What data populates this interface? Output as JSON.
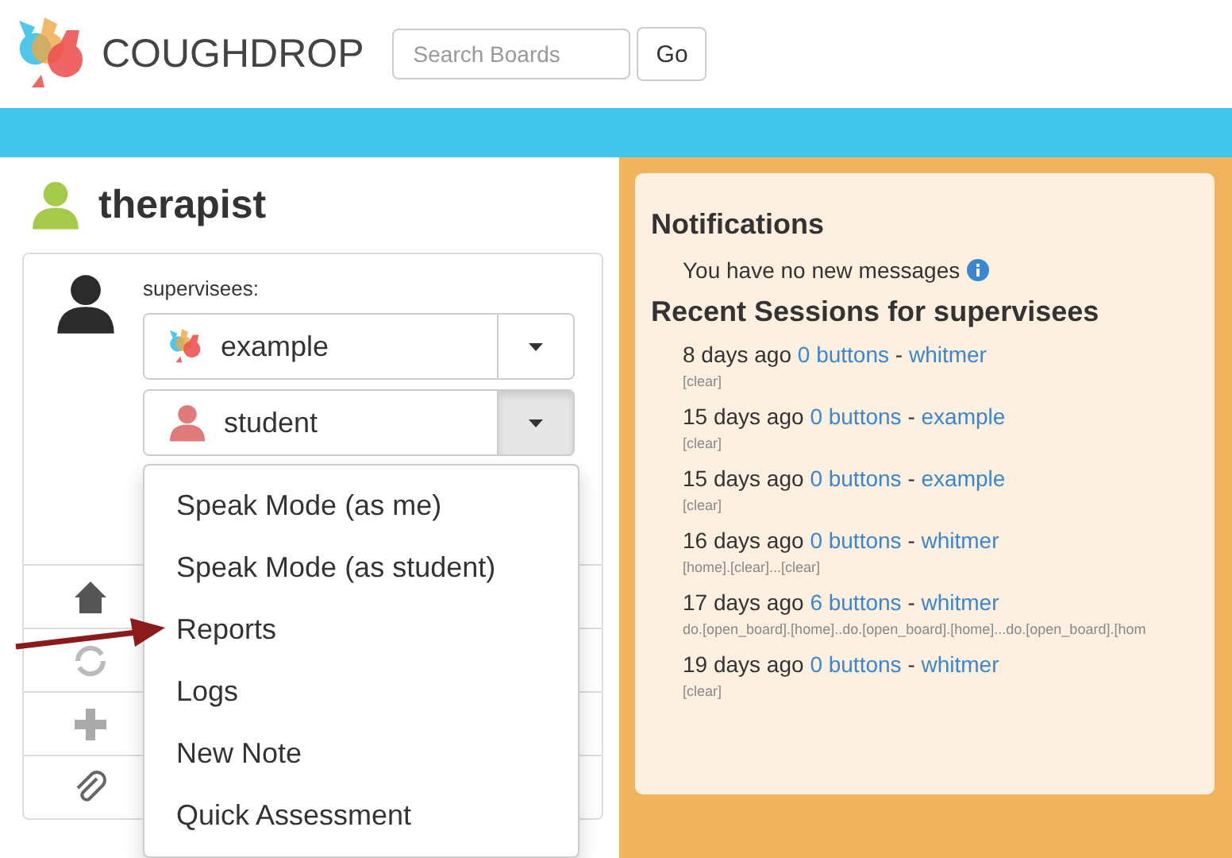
{
  "header": {
    "brand": "COUGHDROP",
    "search": {
      "placeholder": "Search Boards"
    },
    "go_button": "Go"
  },
  "user": {
    "name": "therapist"
  },
  "supervisees": {
    "label": "supervisees:",
    "items": [
      {
        "name": "example",
        "kind": "logo",
        "expanded": false
      },
      {
        "name": "student",
        "kind": "person",
        "expanded": true
      }
    ]
  },
  "menu": [
    "Speak Mode (as me)",
    "Speak Mode (as student)",
    "Reports",
    "Logs",
    "New Note",
    "Quick Assessment"
  ],
  "notifications": {
    "title": "Notifications",
    "message": "You have no new messages"
  },
  "sessions": {
    "title": "Recent Sessions for supervisees",
    "items": [
      {
        "when": "8 days ago",
        "buttons": "0 buttons",
        "separator": "-",
        "user": "whitmer",
        "summary": "[clear]"
      },
      {
        "when": "15 days ago",
        "buttons": "0 buttons",
        "separator": "-",
        "user": "example",
        "summary": "[clear]"
      },
      {
        "when": "15 days ago",
        "buttons": "0 buttons",
        "separator": "-",
        "user": "example",
        "summary": "[clear]"
      },
      {
        "when": "16 days ago",
        "buttons": "0 buttons",
        "separator": "-",
        "user": "whitmer",
        "summary": "[home].[clear]...[clear]"
      },
      {
        "when": "17 days ago",
        "buttons": "6 buttons",
        "separator": "-",
        "user": "whitmer",
        "summary": "do.[open_board].[home]..do.[open_board].[home]...do.[open_board].[hom"
      },
      {
        "when": "19 days ago",
        "buttons": "0 buttons",
        "separator": "-",
        "user": "whitmer",
        "summary": "[clear]"
      }
    ]
  }
}
